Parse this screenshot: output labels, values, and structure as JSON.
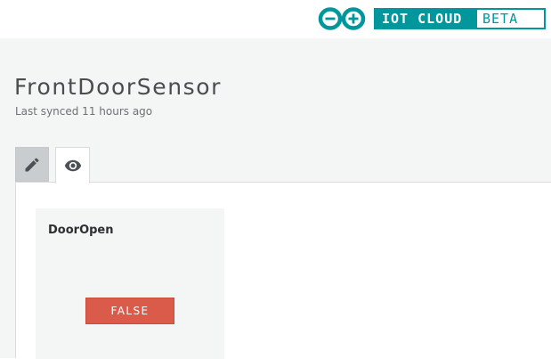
{
  "header": {
    "brand_main": "IOT CLOUD",
    "brand_beta": "BETA",
    "logo_icon": "arduino-logo-icon",
    "accent_color": "#00979c"
  },
  "thing": {
    "title": "FrontDoorSensor",
    "last_synced": "Last synced 11 hours ago"
  },
  "tabs": [
    {
      "icon": "pencil-icon",
      "active": false
    },
    {
      "icon": "eye-icon",
      "active": true
    }
  ],
  "widgets": [
    {
      "name": "DoorOpen",
      "value": "FALSE",
      "value_color": "#da5b4a"
    }
  ]
}
